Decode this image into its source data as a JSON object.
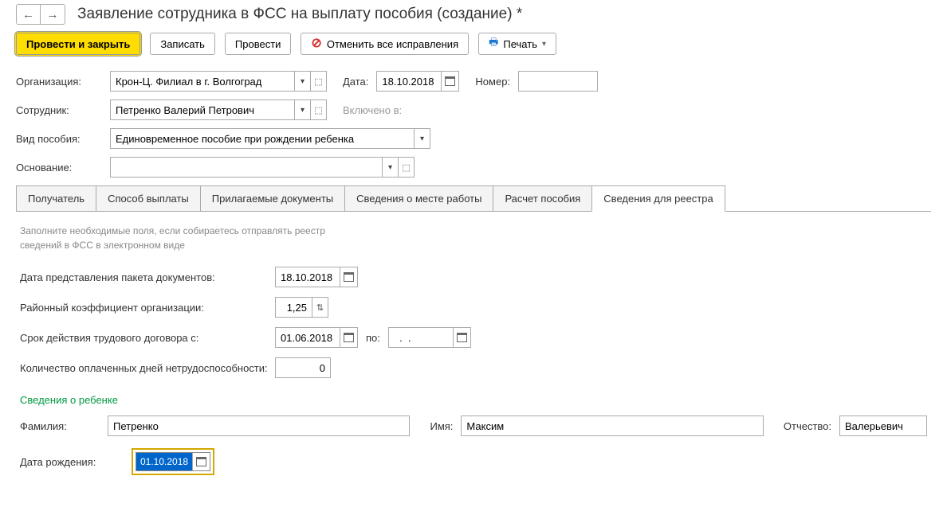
{
  "header": {
    "title": "Заявление сотрудника в ФСС на выплату пособия (создание) *"
  },
  "toolbar": {
    "save_close": "Провести и закрыть",
    "save": "Записать",
    "post": "Провести",
    "undo_all": "Отменить все исправления",
    "print": "Печать"
  },
  "fields": {
    "organization": {
      "label": "Организация:",
      "value": "Крон-Ц. Филиал в г. Волгоград"
    },
    "date": {
      "label": "Дата:",
      "value": "18.10.2018"
    },
    "number": {
      "label": "Номер:",
      "value": ""
    },
    "employee": {
      "label": "Сотрудник:",
      "value": "Петренко Валерий Петрович"
    },
    "included_in": {
      "label": "Включено в:"
    },
    "benefit_type": {
      "label": "Вид пособия:",
      "value": "Единовременное пособие при рождении ребенка"
    },
    "basis": {
      "label": "Основание:",
      "value": ""
    }
  },
  "tabs": [
    "Получатель",
    "Способ выплаты",
    "Прилагаемые документы",
    "Сведения о месте работы",
    "Расчет пособия",
    "Сведения для реестра"
  ],
  "registry": {
    "info": "Заполните необходимые поля, если собираетесь отправлять реестр сведений в ФСС в электронном виде",
    "doc_date": {
      "label": "Дата представления пакета документов:",
      "value": "18.10.2018"
    },
    "district_coeff": {
      "label": "Районный коэффициент организации:",
      "value": "1,25"
    },
    "contract_from": {
      "label": "Срок действия трудового договора с:",
      "value": "01.06.2018"
    },
    "contract_to": {
      "label": "по:",
      "value": "  .  .    "
    },
    "paid_days": {
      "label": "Количество оплаченных дней нетрудоспособности:",
      "value": "0"
    },
    "child_section": "Сведения о ребенке",
    "lastname": {
      "label": "Фамилия:",
      "value": "Петренко"
    },
    "firstname": {
      "label": "Имя:",
      "value": "Максим"
    },
    "middlename": {
      "label": "Отчество:",
      "value": "Валерьевич"
    },
    "birthdate": {
      "label": "Дата рождения:",
      "value": "01.10.2018"
    }
  }
}
